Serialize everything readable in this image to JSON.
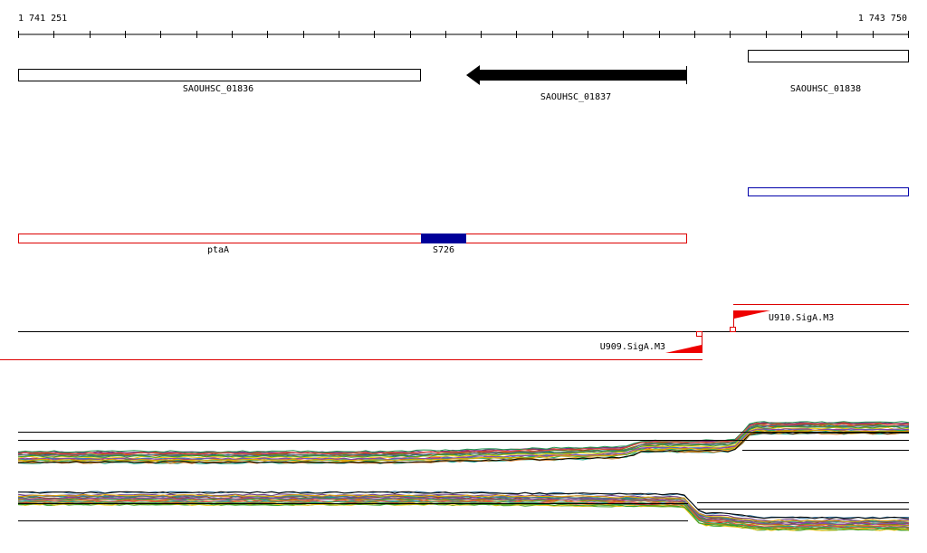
{
  "ruler": {
    "start_label": "1 741 251",
    "end_label": "1 743 750"
  },
  "genes": [
    {
      "label": "SAOUHSC_01836",
      "style": "outline"
    },
    {
      "label": "SAOUHSC_01837",
      "style": "reverse-arrow"
    },
    {
      "label": "SAOUHSC_01838",
      "style": "outline"
    }
  ],
  "segments": {
    "primary_label": "ptaA",
    "highlight_label": "S726",
    "segment_color": "#dd0000",
    "highlight_color": "#000099",
    "second_track_color": "#0000aa"
  },
  "terminators": [
    {
      "label": "U910.SigA.M3",
      "strand": "+"
    },
    {
      "label": "U909.SigA.M3",
      "strand": "-"
    }
  ],
  "colors": {
    "feature_line": "#dd0000",
    "track_line": "#000000"
  }
}
